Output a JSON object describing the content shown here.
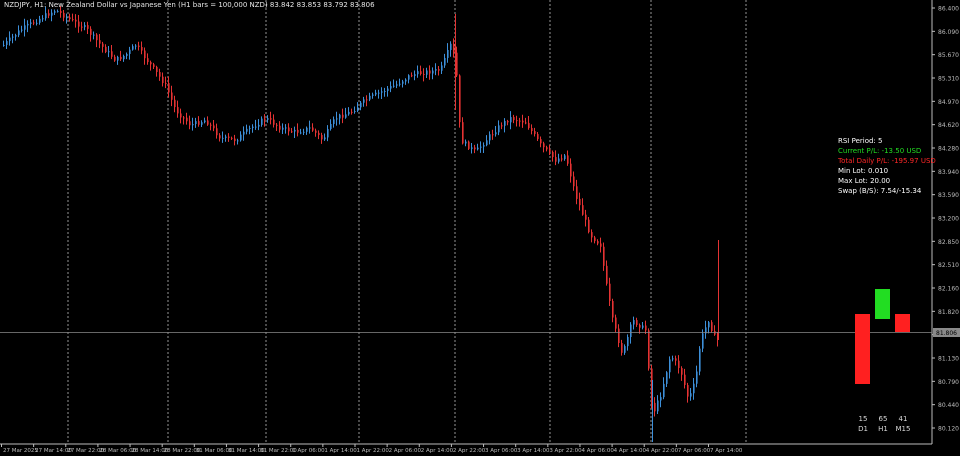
{
  "title": "NZDJPY, H1: New Zealand Dollar vs Japanese Yen (H1 bars = 100,000 NZD)  83.842 83.853 83.792 83.806",
  "colors": {
    "background": "#000000",
    "bull": "#3d8fd9",
    "bear": "#e53333",
    "grid": "#cfcfcf",
    "axis": "#bdbdbd",
    "profit": "#22dd22",
    "loss": "#ff2020",
    "text": "#ffffff"
  },
  "price_axis": {
    "labels": [
      "86.400",
      "86.090",
      "85.670",
      "85.310",
      "84.970",
      "84.620",
      "84.280",
      "83.940",
      "83.590",
      "83.200",
      "82.850",
      "82.510",
      "82.160",
      "81.820",
      "81.480",
      "81.130",
      "80.790",
      "80.440",
      "80.120"
    ],
    "current_price": "81.806"
  },
  "time_axis": {
    "labels": [
      "27 Mar 2025",
      "27 Mar 14:00",
      "27 Mar 22:00",
      "28 Mar 06:00",
      "28 Mar 14:00",
      "28 Mar 22:00",
      "31 Mar 06:00",
      "31 Mar 14:00",
      "31 Mar 22:00",
      "1 Apr 06:00",
      "1 Apr 14:00",
      "1 Apr 22:00",
      "2 Apr 06:00",
      "2 Apr 14:00",
      "2 Apr 22:00",
      "3 Apr 06:00",
      "3 Apr 14:00",
      "3 Apr 22:00",
      "4 Apr 06:00",
      "4 Apr 14:00",
      "4 Apr 22:00",
      "7 Apr 06:00",
      "7 Apr 14:00"
    ]
  },
  "info_panel": {
    "rsi_period": "RSI Period: 5",
    "current_pl": "Current P/L: -13.50 USD",
    "total_daily_pl": "Total Daily P/L: -195.97 USD",
    "min_lot": "Min Lot: 0.010",
    "max_lot": "Max Lot: 20.00",
    "swap": "Swap (B/S): 7.54/-15.34"
  },
  "rsi_indicator": [
    {
      "tf": "D1",
      "value": "15",
      "level": 15
    },
    {
      "tf": "H1",
      "value": "65",
      "level": 65
    },
    {
      "tf": "M15",
      "value": "41",
      "level": 41
    }
  ]
}
